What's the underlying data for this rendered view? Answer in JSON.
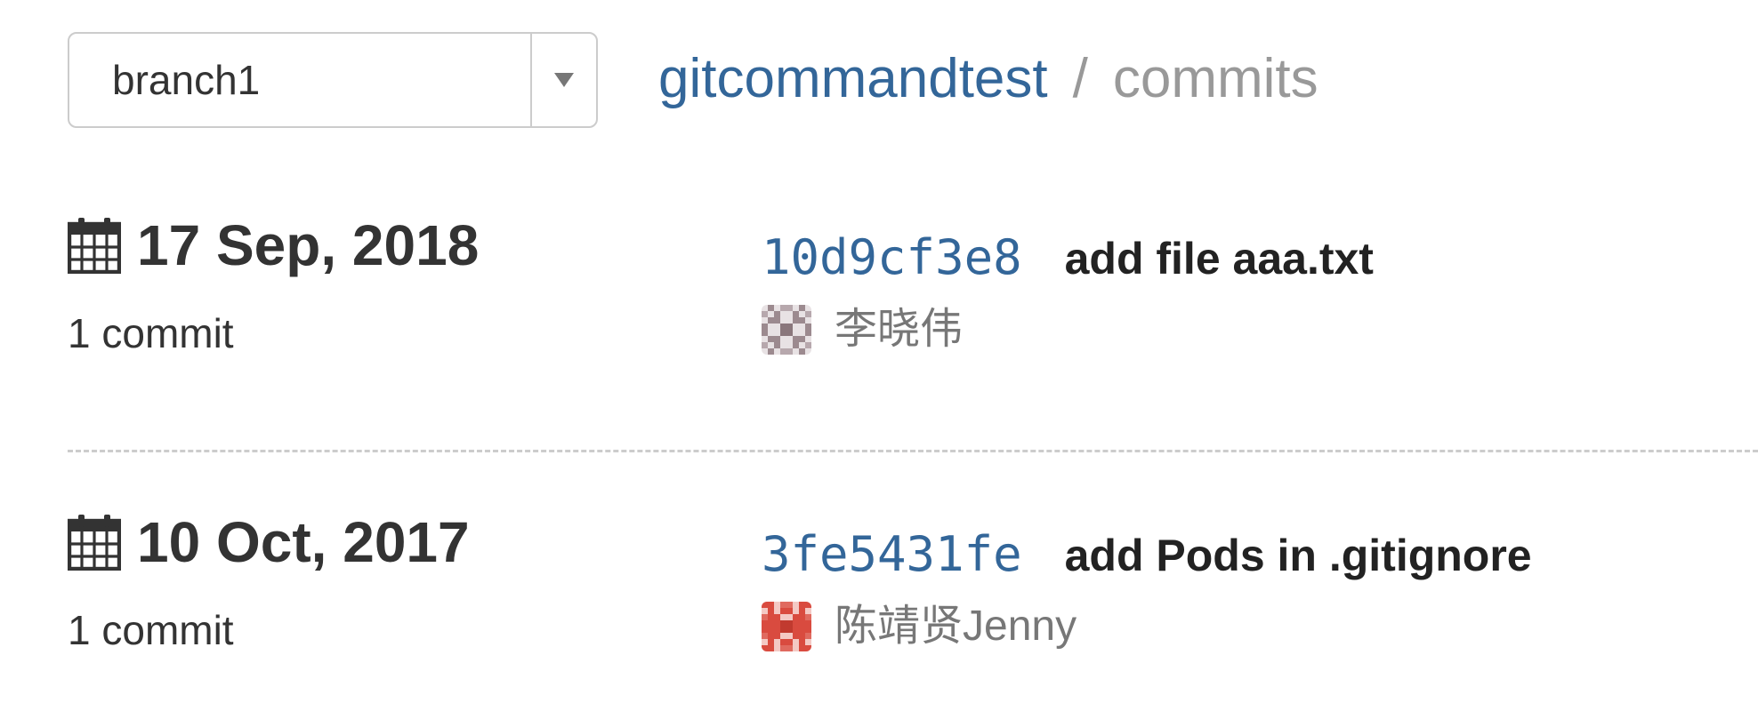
{
  "branch_select": {
    "value": "branch1"
  },
  "breadcrumb": {
    "repo": "gitcommandtest",
    "separator": "/",
    "page": "commits"
  },
  "days": [
    {
      "date": "17 Sep, 2018",
      "count": "1 commit",
      "commits": [
        {
          "sha": "10d9cf3e8",
          "message": "add file aaa.txt",
          "author": "李晓伟",
          "avatar_color": "#9c8a8f"
        }
      ]
    },
    {
      "date": "10 Oct, 2017",
      "count": "1 commit",
      "commits": [
        {
          "sha": "3fe5431fe",
          "message": "add Pods in .gitignore",
          "author": "陈靖贤Jenny",
          "avatar_color": "#d94b3f"
        }
      ]
    }
  ],
  "colors": {
    "link": "#336699",
    "muted": "#999999",
    "author": "#777777"
  },
  "icons": {
    "calendar": "calendar-icon",
    "dropdown": "caret-down-icon"
  }
}
